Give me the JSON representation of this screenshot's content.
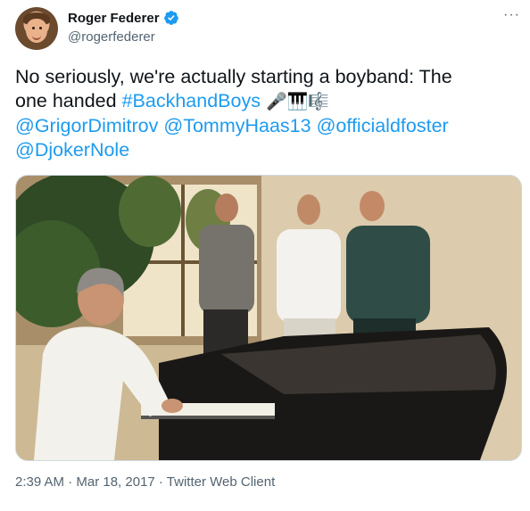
{
  "tweet": {
    "display_name": "Roger Federer",
    "handle": "@rogerfederer",
    "more_label": "···",
    "text_line1": "No seriously, we're actually starting a boyband: The",
    "text_line2_prefix": "one handed ",
    "hashtag": "#BackhandBoys",
    "emojis": "🎤🎹🎼",
    "mentions": [
      "@GrigorDimitrov",
      "@TommyHaas13",
      "@officialdfoster",
      "@DjokerNole"
    ],
    "timestamp": "2:39 AM · Mar 18, 2017 · Twitter Web Client"
  },
  "colors": {
    "link": "#1d9bf0",
    "secondary_text": "#536471",
    "verified_badge": "#1d9bf0"
  },
  "icons": {
    "verified": "verified-badge-icon",
    "more": "more-options-icon"
  }
}
